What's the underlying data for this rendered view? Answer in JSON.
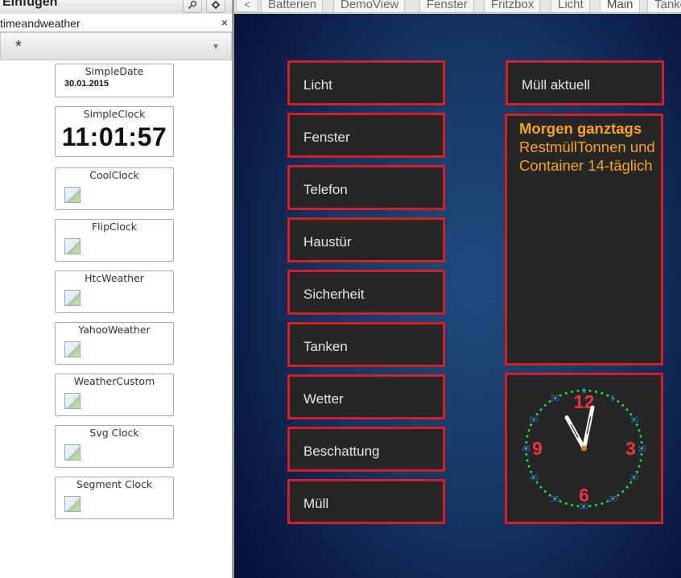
{
  "left_panel": {
    "title": "Einfügen",
    "widget_set": "timeandweather",
    "close_symbol": "×",
    "filter_value": "*",
    "filter_arrow": "▼",
    "widgets": [
      {
        "name": "SimpleDate",
        "value": "30.01.2015"
      },
      {
        "name": "SimpleClock",
        "value": "11:01:57"
      },
      {
        "name": "CoolClock"
      },
      {
        "name": "FlipClock"
      },
      {
        "name": "HtcWeather"
      },
      {
        "name": "YahooWeather"
      },
      {
        "name": "WeatherCustom"
      },
      {
        "name": "Svg Clock"
      },
      {
        "name": "Segment Clock"
      }
    ]
  },
  "tab_bar": {
    "prev_symbol": "<",
    "tabs": [
      "Batterien",
      "DemoView",
      "Fenster",
      "Fritzbox",
      "Licht",
      "Main",
      "Tanke"
    ],
    "active_tab": "Main"
  },
  "view": {
    "buttons": [
      "Licht",
      "Fenster",
      "Telefon",
      "Haustür",
      "Sicherheit",
      "Tanken",
      "Wetter",
      "Beschattung",
      "Müll"
    ],
    "muell_aktuell_label": "Müll aktuell",
    "muell_heading": "Morgen ganztags",
    "muell_text": "RestmüllTonnen und Container 14-täglich",
    "clock": {
      "hour_numerals": [
        "12",
        "3",
        "6",
        "9"
      ],
      "minute_labels": [
        "0",
        "5",
        "10",
        "15",
        "20",
        "25",
        "30",
        "35",
        "40",
        "45",
        "50",
        "55"
      ],
      "time": "11:01:57",
      "colors": {
        "numerals": "#e8343a",
        "minute_labels": "#2f63d6",
        "dots": "#22e33a",
        "hands": "#ffffff",
        "center": "#e07f22"
      }
    }
  },
  "colors": {
    "button_border": "#d41f26",
    "button_bg": "#262626",
    "muell_text": "#f7a41b"
  }
}
